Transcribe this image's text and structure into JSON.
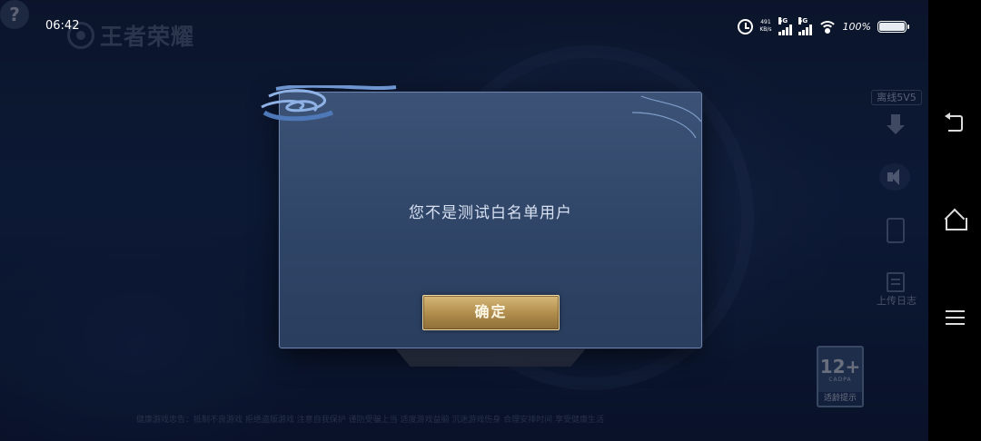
{
  "status_bar": {
    "time": "06:42",
    "net_speed_value": "491",
    "net_speed_unit": "KB/s",
    "sim1_label": "5G",
    "sim2_label": "5G",
    "battery_percent": "100%",
    "icons": [
      "alarm-icon",
      "signal-icon",
      "wifi-icon",
      "battery-icon"
    ]
  },
  "game": {
    "logo_text": "王者荣耀",
    "offline_label": "离线5V5",
    "upload_log_label": "上传日志",
    "age_rating": {
      "number": "12+",
      "org": "CADPA",
      "tip": "适龄提示"
    },
    "footer_text": "健康游戏忠告：抵制不良游戏 拒绝盗版游戏 注意自我保护 谨防受骗上当 适度游戏益脑 沉迷游戏伤身 合理安排时间 享受健康生活"
  },
  "dialog": {
    "message": "您不是测试白名单用户",
    "confirm_label": "确定"
  },
  "colors": {
    "dialog_bg": "#2f4567",
    "dialog_border": "#6c83ab",
    "button_gold": "#b28f4e",
    "nav_bg": "#000000"
  }
}
